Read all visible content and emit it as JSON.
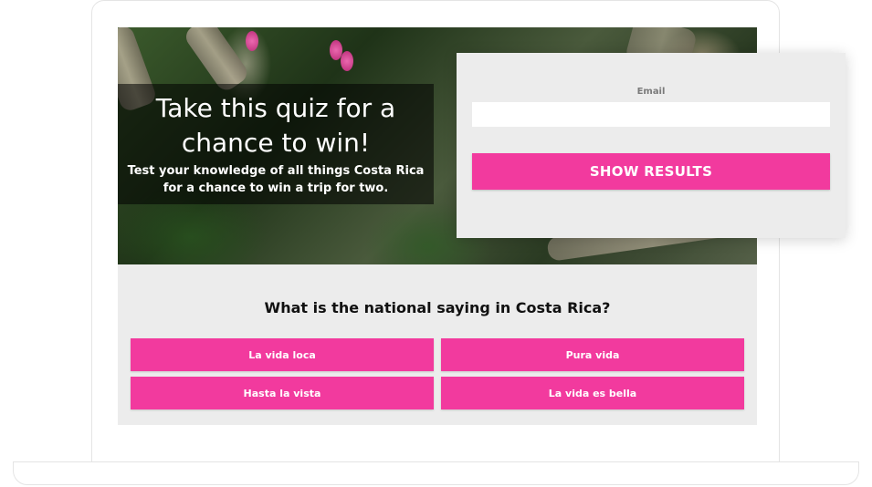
{
  "hero": {
    "title": "Take this quiz for a chance to win!",
    "subtitle": "Test your knowledge of all things Costa Rica for a chance to win a trip for two."
  },
  "email_form": {
    "label": "Email",
    "value": "",
    "placeholder": "",
    "submit_label": "SHOW RESULTS"
  },
  "quiz": {
    "question": "What is the national saying in Costa Rica?",
    "answers": [
      "La vida loca",
      "Pura vida",
      "Hasta la vista",
      "La vida es bella"
    ]
  },
  "colors": {
    "accent": "#f23a9e",
    "panel_bg": "#ececec",
    "overlay": "rgba(0,0,0,0.55)"
  }
}
